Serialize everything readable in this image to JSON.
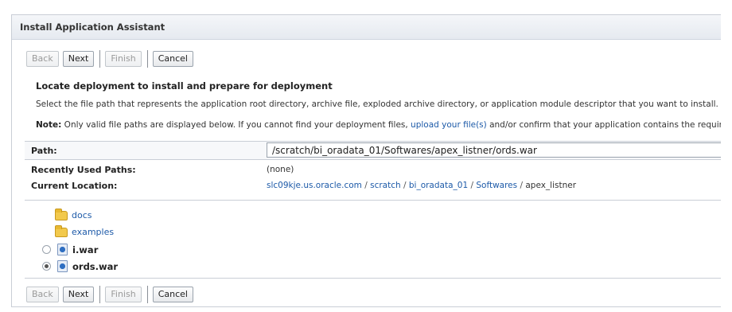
{
  "window": {
    "title": "Install Application Assistant"
  },
  "toolbar": {
    "back": "Back",
    "next": "Next",
    "finish": "Finish",
    "cancel": "Cancel"
  },
  "content": {
    "heading": "Locate deployment to install and prepare for deployment",
    "description": "Select the file path that represents the application root directory, archive file, exploded archive directory, or application module descriptor that you want to install. Yo",
    "note": {
      "label": "Note:",
      "text_before": " Only valid file paths are displayed below. If you cannot find your deployment files, ",
      "link": "upload your file(s)",
      "text_after": " and/or confirm that your application contains the requir"
    }
  },
  "properties": {
    "path": {
      "label": "Path:",
      "value": "/scratch/bi_oradata_01/Softwares/apex_listner/ords.war"
    },
    "recent": {
      "label": "Recently Used Paths:",
      "value": "(none)"
    },
    "current": {
      "label": "Current Location:",
      "crumbs": [
        "slc09kje.us.oracle.com",
        "scratch",
        "bi_oradata_01",
        "Softwares"
      ],
      "separator": " / ",
      "last": "apex_listner"
    }
  },
  "files": {
    "folders": [
      "docs",
      "examples"
    ],
    "archives": [
      {
        "name": "i.war",
        "selected": false
      },
      {
        "name": "ords.war",
        "selected": true
      }
    ]
  },
  "colors": {
    "link": "#1d5aa8",
    "folder": "#f2c94c",
    "border": "#c9ced6"
  }
}
